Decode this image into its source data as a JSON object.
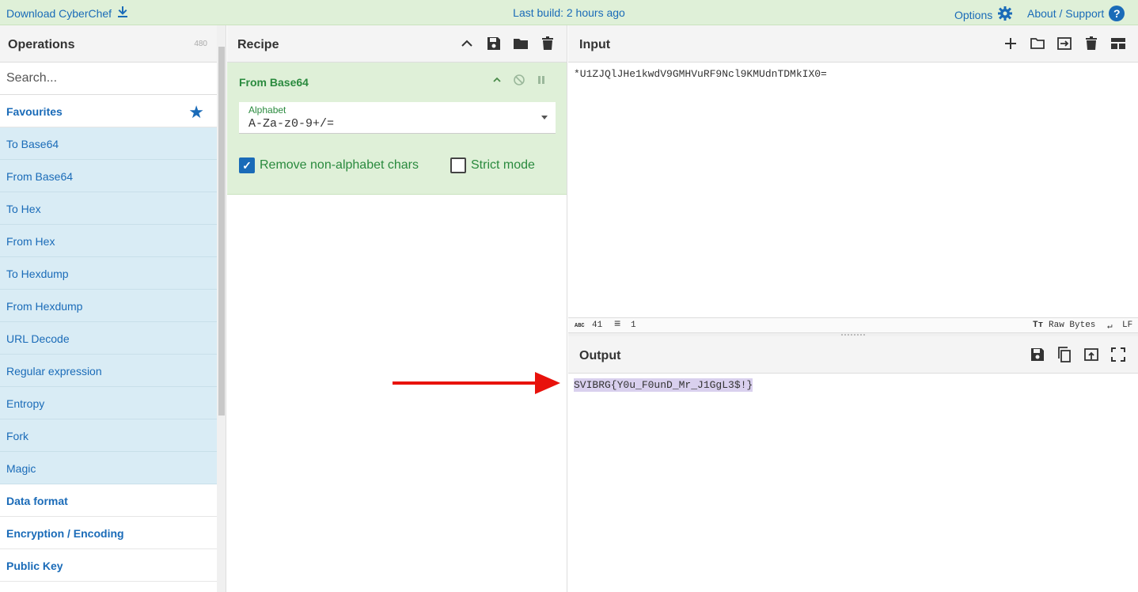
{
  "banner": {
    "download_label": "Download CyberChef",
    "build_label": "Last build: 2 hours ago",
    "options_label": "Options",
    "about_label": "About / Support",
    "about_icon": "?"
  },
  "operations": {
    "title": "Operations",
    "count": "480",
    "search_placeholder": "Search...",
    "favourites_label": "Favourites",
    "favourites": [
      "To Base64",
      "From Base64",
      "To Hex",
      "From Hex",
      "To Hexdump",
      "From Hexdump",
      "URL Decode",
      "Regular expression",
      "Entropy",
      "Fork",
      "Magic"
    ],
    "categories": [
      "Data format",
      "Encryption / Encoding",
      "Public Key"
    ]
  },
  "recipe": {
    "title": "Recipe",
    "operation": {
      "name": "From Base64",
      "alphabet_label": "Alphabet",
      "alphabet_value": "A-Za-z0-9+/=",
      "remove_nonalpha_label": "Remove non-alphabet chars",
      "remove_nonalpha_checked": true,
      "strict_mode_label": "Strict mode",
      "strict_mode_checked": false,
      "checkmark": "✓"
    }
  },
  "input": {
    "title": "Input",
    "text": "*U1ZJQlJHe1kwdV9GMHVuRF9Ncl9KMUdnTDMkIX0=",
    "status": {
      "length": "41",
      "lines": "1",
      "encoding": "Raw Bytes",
      "eol": "LF",
      "length_icon": "ABC",
      "lines_icon": "≡",
      "encoding_icon": "Tт",
      "eol_icon": "↵"
    }
  },
  "output": {
    "title": "Output",
    "text": "SVIBRG{Y0u_F0unD_Mr_J1GgL3$!}"
  },
  "colors": {
    "banner_bg": "#dff0d8",
    "link_blue": "#1a6bb8",
    "favourite_bg": "#d9ecf5",
    "recipe_green": "#2a8a3e",
    "output_highlight": "#d9d0ee",
    "arrow_red": "#e8120c"
  }
}
